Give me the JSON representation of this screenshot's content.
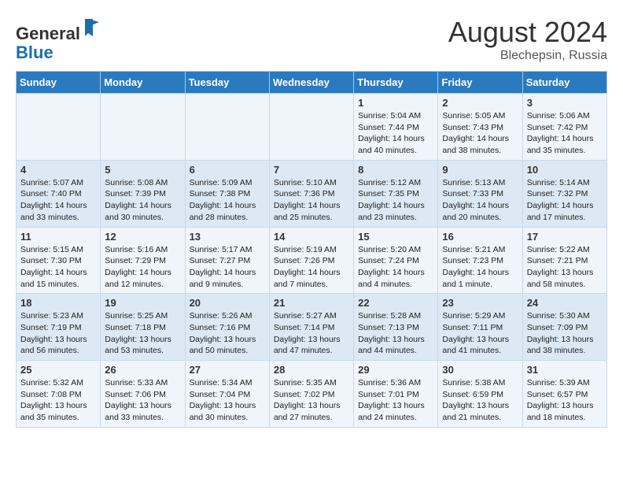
{
  "header": {
    "logo_general": "General",
    "logo_blue": "Blue",
    "month_year": "August 2024",
    "location": "Blechepsin, Russia"
  },
  "days_of_week": [
    "Sunday",
    "Monday",
    "Tuesday",
    "Wednesday",
    "Thursday",
    "Friday",
    "Saturday"
  ],
  "weeks": [
    [
      {
        "day": "",
        "info": ""
      },
      {
        "day": "",
        "info": ""
      },
      {
        "day": "",
        "info": ""
      },
      {
        "day": "",
        "info": ""
      },
      {
        "day": "1",
        "info": "Sunrise: 5:04 AM\nSunset: 7:44 PM\nDaylight: 14 hours\nand 40 minutes."
      },
      {
        "day": "2",
        "info": "Sunrise: 5:05 AM\nSunset: 7:43 PM\nDaylight: 14 hours\nand 38 minutes."
      },
      {
        "day": "3",
        "info": "Sunrise: 5:06 AM\nSunset: 7:42 PM\nDaylight: 14 hours\nand 35 minutes."
      }
    ],
    [
      {
        "day": "4",
        "info": "Sunrise: 5:07 AM\nSunset: 7:40 PM\nDaylight: 14 hours\nand 33 minutes."
      },
      {
        "day": "5",
        "info": "Sunrise: 5:08 AM\nSunset: 7:39 PM\nDaylight: 14 hours\nand 30 minutes."
      },
      {
        "day": "6",
        "info": "Sunrise: 5:09 AM\nSunset: 7:38 PM\nDaylight: 14 hours\nand 28 minutes."
      },
      {
        "day": "7",
        "info": "Sunrise: 5:10 AM\nSunset: 7:36 PM\nDaylight: 14 hours\nand 25 minutes."
      },
      {
        "day": "8",
        "info": "Sunrise: 5:12 AM\nSunset: 7:35 PM\nDaylight: 14 hours\nand 23 minutes."
      },
      {
        "day": "9",
        "info": "Sunrise: 5:13 AM\nSunset: 7:33 PM\nDaylight: 14 hours\nand 20 minutes."
      },
      {
        "day": "10",
        "info": "Sunrise: 5:14 AM\nSunset: 7:32 PM\nDaylight: 14 hours\nand 17 minutes."
      }
    ],
    [
      {
        "day": "11",
        "info": "Sunrise: 5:15 AM\nSunset: 7:30 PM\nDaylight: 14 hours\nand 15 minutes."
      },
      {
        "day": "12",
        "info": "Sunrise: 5:16 AM\nSunset: 7:29 PM\nDaylight: 14 hours\nand 12 minutes."
      },
      {
        "day": "13",
        "info": "Sunrise: 5:17 AM\nSunset: 7:27 PM\nDaylight: 14 hours\nand 9 minutes."
      },
      {
        "day": "14",
        "info": "Sunrise: 5:19 AM\nSunset: 7:26 PM\nDaylight: 14 hours\nand 7 minutes."
      },
      {
        "day": "15",
        "info": "Sunrise: 5:20 AM\nSunset: 7:24 PM\nDaylight: 14 hours\nand 4 minutes."
      },
      {
        "day": "16",
        "info": "Sunrise: 5:21 AM\nSunset: 7:23 PM\nDaylight: 14 hours\nand 1 minute."
      },
      {
        "day": "17",
        "info": "Sunrise: 5:22 AM\nSunset: 7:21 PM\nDaylight: 13 hours\nand 58 minutes."
      }
    ],
    [
      {
        "day": "18",
        "info": "Sunrise: 5:23 AM\nSunset: 7:19 PM\nDaylight: 13 hours\nand 56 minutes."
      },
      {
        "day": "19",
        "info": "Sunrise: 5:25 AM\nSunset: 7:18 PM\nDaylight: 13 hours\nand 53 minutes."
      },
      {
        "day": "20",
        "info": "Sunrise: 5:26 AM\nSunset: 7:16 PM\nDaylight: 13 hours\nand 50 minutes."
      },
      {
        "day": "21",
        "info": "Sunrise: 5:27 AM\nSunset: 7:14 PM\nDaylight: 13 hours\nand 47 minutes."
      },
      {
        "day": "22",
        "info": "Sunrise: 5:28 AM\nSunset: 7:13 PM\nDaylight: 13 hours\nand 44 minutes."
      },
      {
        "day": "23",
        "info": "Sunrise: 5:29 AM\nSunset: 7:11 PM\nDaylight: 13 hours\nand 41 minutes."
      },
      {
        "day": "24",
        "info": "Sunrise: 5:30 AM\nSunset: 7:09 PM\nDaylight: 13 hours\nand 38 minutes."
      }
    ],
    [
      {
        "day": "25",
        "info": "Sunrise: 5:32 AM\nSunset: 7:08 PM\nDaylight: 13 hours\nand 35 minutes."
      },
      {
        "day": "26",
        "info": "Sunrise: 5:33 AM\nSunset: 7:06 PM\nDaylight: 13 hours\nand 33 minutes."
      },
      {
        "day": "27",
        "info": "Sunrise: 5:34 AM\nSunset: 7:04 PM\nDaylight: 13 hours\nand 30 minutes."
      },
      {
        "day": "28",
        "info": "Sunrise: 5:35 AM\nSunset: 7:02 PM\nDaylight: 13 hours\nand 27 minutes."
      },
      {
        "day": "29",
        "info": "Sunrise: 5:36 AM\nSunset: 7:01 PM\nDaylight: 13 hours\nand 24 minutes."
      },
      {
        "day": "30",
        "info": "Sunrise: 5:38 AM\nSunset: 6:59 PM\nDaylight: 13 hours\nand 21 minutes."
      },
      {
        "day": "31",
        "info": "Sunrise: 5:39 AM\nSunset: 6:57 PM\nDaylight: 13 hours\nand 18 minutes."
      }
    ]
  ]
}
